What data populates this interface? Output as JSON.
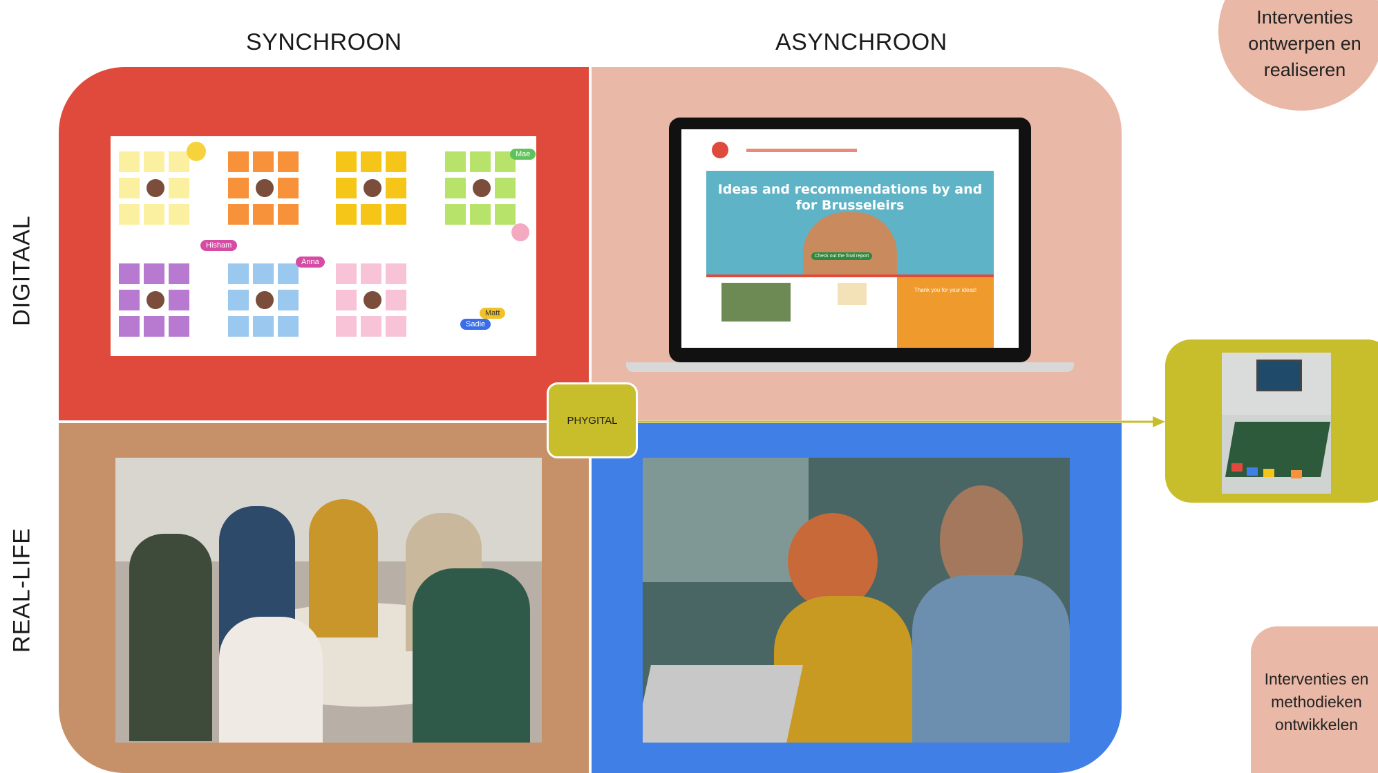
{
  "columns": {
    "synchronous": "SYNCHROON",
    "asynchronous": "ASYNCHROON"
  },
  "rows": {
    "digital": "DIGITAAL",
    "real_life": "REAL-LIFE"
  },
  "center_label": "PHYGITAL",
  "bubbles": {
    "top_right": "Interventies ontwerpen en realiseren",
    "bottom_right": "Interventies en methodieken ontwikkelen"
  },
  "whiteboard": {
    "cursors": [
      "Hisham",
      "Anna",
      "Mae",
      "Matt",
      "Sadie"
    ]
  },
  "website": {
    "hero_title": "Ideas and recommendations by and for Brusseleirs",
    "hero_button": "Check out the final report",
    "side_panel": "Thank you for your ideas!"
  },
  "colors": {
    "digital_sync": "#e04a3c",
    "digital_async": "#eab8a6",
    "real_sync": "#c69068",
    "real_async": "#3f7fe6",
    "phygital": "#c8bd2a"
  }
}
